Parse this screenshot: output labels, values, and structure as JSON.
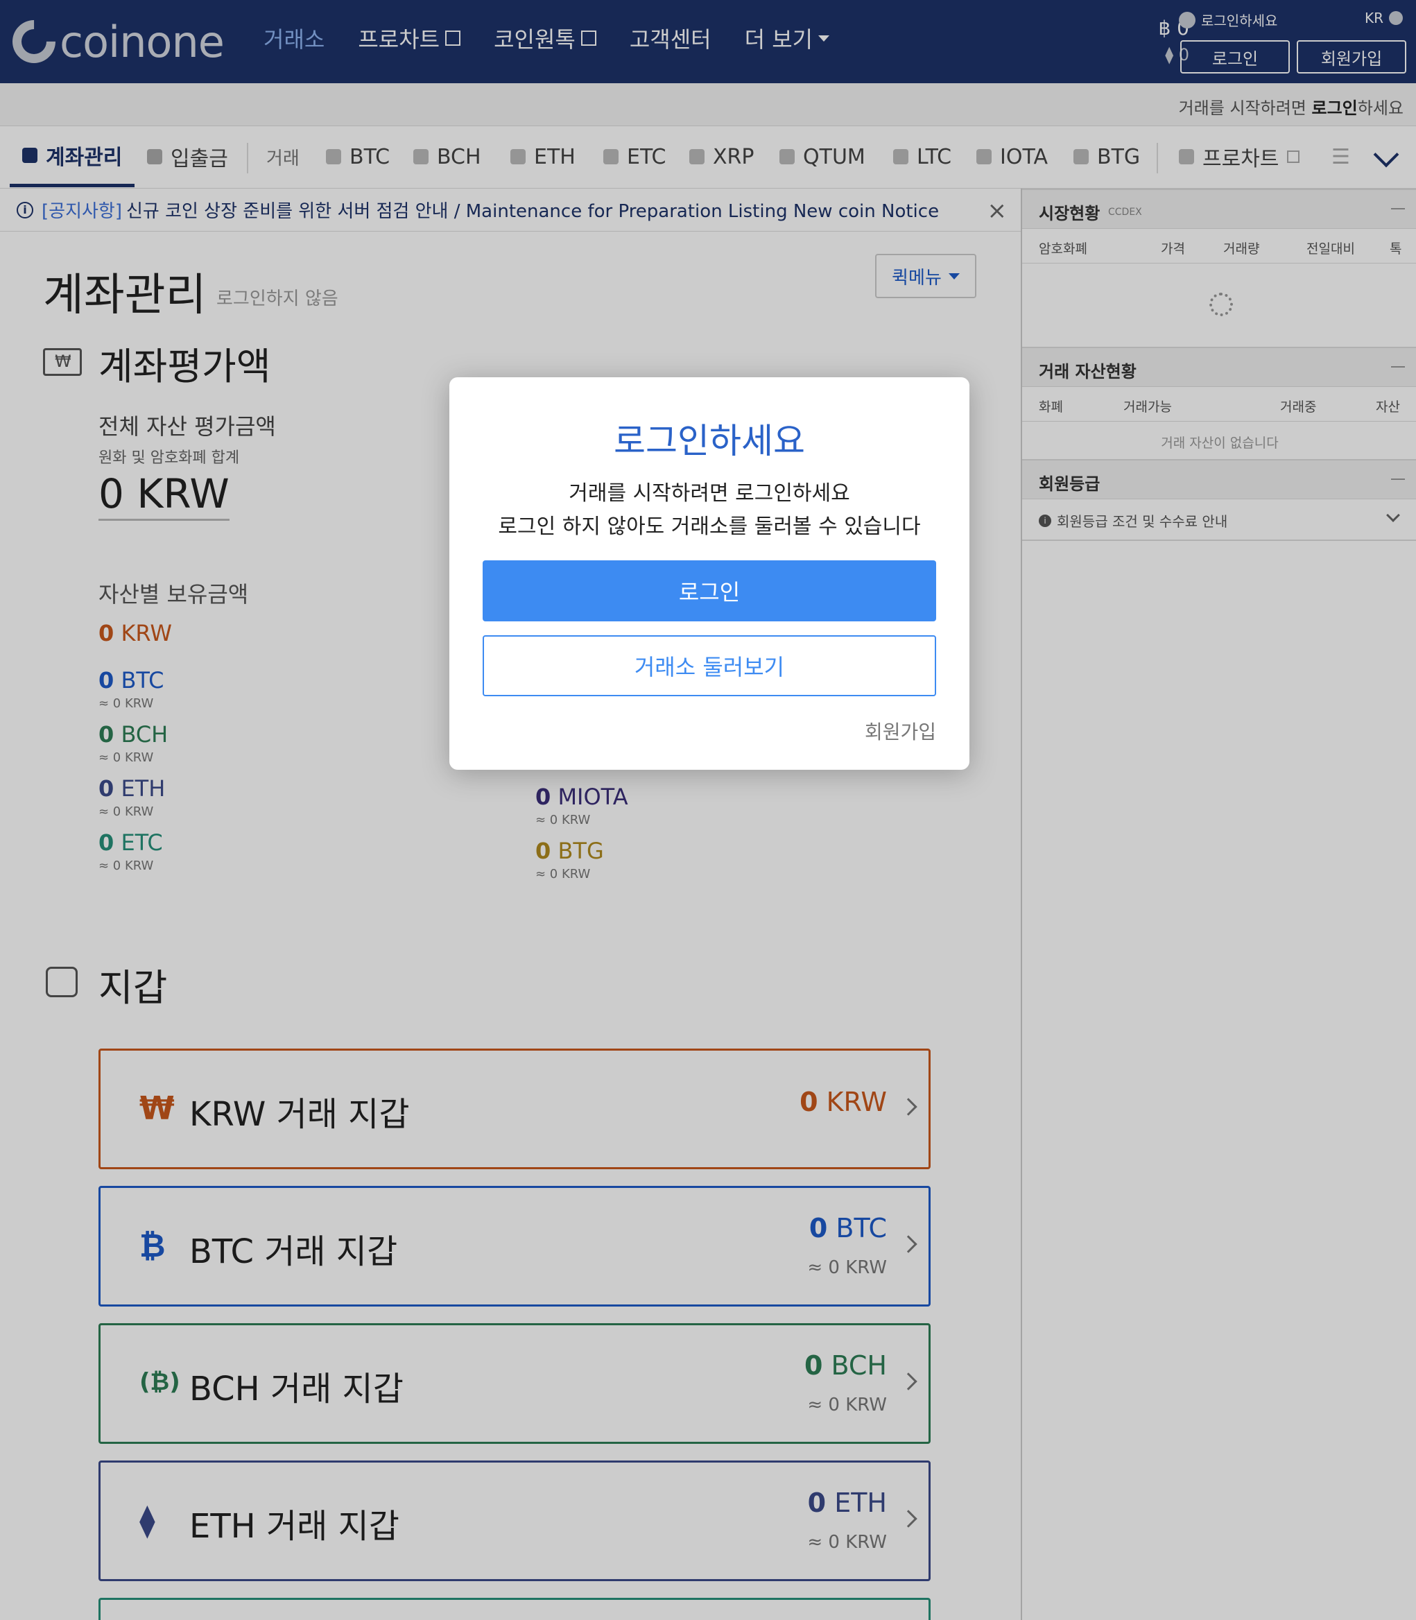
{
  "header": {
    "logo_text": "coinone",
    "nav": [
      {
        "label": "거래소"
      },
      {
        "label": "프로차트"
      },
      {
        "label": "코인원톡"
      },
      {
        "label": "고객센터"
      },
      {
        "label": "더 보기"
      }
    ],
    "btc_balance": "฿ 0",
    "eth_balance": "⧫ 0",
    "user_prompt": "로그인하세요",
    "lang": "KR",
    "login_button": "로그인",
    "signup_button": "회원가입"
  },
  "subbar": {
    "text_prefix": "거래를 시작하려면 ",
    "text_bold": "로그인",
    "text_suffix": "하세요"
  },
  "tabs": {
    "account": "계좌관리",
    "deposit": "입출금",
    "trade": "거래",
    "coins": [
      "BTC",
      "BCH",
      "ETH",
      "ETC",
      "XRP",
      "QTUM",
      "LTC",
      "IOTA",
      "BTG"
    ],
    "prochart": "프로차트"
  },
  "notice": {
    "tag": "[공지사항]",
    "text": "신규 코인 상장 준비를 위한 서버 점검 안내 / Maintenance for Preparation Listing New coin Notice",
    "close": "×"
  },
  "account": {
    "title": "계좌관리",
    "subtitle": "로그인하지 않음",
    "quick_menu": "퀵메뉴",
    "valuation_title": "계좌평가액",
    "total_label": "전체 자산 평가금액",
    "total_sub": "원화 및 암호화폐 합계",
    "total_value": "0 KRW",
    "holdings_title": "자산별 보유금액",
    "krw_zero": "0",
    "krw_unit": "KRW",
    "left_coins": [
      {
        "zero": "0",
        "unit": "BTC",
        "krw": "≈ 0 KRW",
        "color": "#1d5ac8"
      },
      {
        "zero": "0",
        "unit": "BCH",
        "krw": "≈ 0 KRW",
        "color": "#2e7d55"
      },
      {
        "zero": "0",
        "unit": "ETH",
        "krw": "≈ 0 KRW",
        "color": "#3b4a8a"
      },
      {
        "zero": "0",
        "unit": "ETC",
        "krw": "≈ 0 KRW",
        "color": "#26907a"
      }
    ],
    "right_coins": [
      {
        "zero": "0",
        "unit": "MIOTA",
        "krw": "≈ 0 KRW",
        "color": "#3b2f7a"
      },
      {
        "zero": "0",
        "unit": "BTG",
        "krw": "≈ 0 KRW",
        "color": "#b08a1e"
      }
    ],
    "wallet_title": "지갑",
    "wallets": [
      {
        "icon": "₩",
        "name": "KRW 거래 지갑",
        "zero": "0",
        "unit": "KRW",
        "krw": "",
        "color": "#c9581c"
      },
      {
        "icon": "₿",
        "name": "BTC 거래 지갑",
        "zero": "0",
        "unit": "BTC",
        "krw": "≈ 0 KRW",
        "color": "#1d5ac8"
      },
      {
        "icon": "(₿)",
        "name": "BCH 거래 지갑",
        "zero": "0",
        "unit": "BCH",
        "krw": "≈ 0 KRW",
        "color": "#2e7d55"
      },
      {
        "icon": "⧫",
        "name": "ETH 거래 지갑",
        "zero": "0",
        "unit": "ETH",
        "krw": "≈ 0 KRW",
        "color": "#3b4a8a"
      }
    ]
  },
  "right_panel": {
    "market_title": "시장현황",
    "market_sub": "CCDEX",
    "market_cols": [
      "암호화폐",
      "가격",
      "거래량",
      "전일대비",
      "톡"
    ],
    "assets_title": "거래 자산현황",
    "assets_cols": [
      "화폐",
      "거래가능",
      "거래중",
      "자산"
    ],
    "assets_empty": "거래 자산이 없습니다",
    "grade_title": "회원등급",
    "grade_info": "회원등급 조건 및 수수료 안내"
  },
  "modal": {
    "title": "로그인하세요",
    "line1": "거래를 시작하려면 로그인하세요",
    "line2": "로그인 하지 않아도 거래소를 둘러볼 수 있습니다",
    "login": "로그인",
    "browse": "거래소 둘러보기",
    "signup": "회원가입"
  }
}
